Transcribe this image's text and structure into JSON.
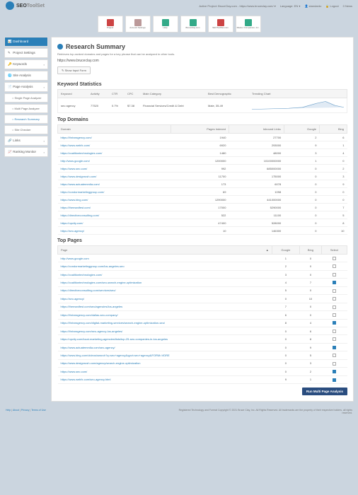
{
  "brand": {
    "main": "SEO",
    "tool": "ToolSet"
  },
  "header": {
    "project": "Active Project: BruceClay.com - https://www.bruceclay.com/ ▾",
    "language": "Language: EN ▾",
    "user": "👤 standardo",
    "logout": "🔒 Logout",
    "notif": "0 News"
  },
  "toolbar": [
    {
      "name": "project",
      "label": "Project",
      "color": "#c44"
    },
    {
      "name": "account",
      "label": "Account Settings",
      "color": "#b99"
    },
    {
      "name": "help",
      "label": "Help",
      "color": "#3a8"
    },
    {
      "name": "bruceclay",
      "label": "BruceClay.com",
      "color": "#3a8"
    },
    {
      "name": "seotoolset",
      "label": "SEOToolSet.com",
      "color": "#c44"
    },
    {
      "name": "master",
      "label": "Master Companion, Inc.",
      "color": "#3a8"
    }
  ],
  "sidebar": {
    "items": [
      {
        "label": "Dashboard",
        "active": true,
        "icon": "📊"
      },
      {
        "label": "Project Settings",
        "icon": "✎",
        "expand": ""
      },
      {
        "label": "Keywords",
        "icon": "🔑",
        "expand": "▪"
      },
      {
        "label": "Site Analysis",
        "icon": "🌐",
        "expand": ""
      },
      {
        "label": "Page Analysis",
        "icon": "📄",
        "expand": "▪",
        "open": true
      },
      {
        "label": "Links",
        "icon": "🔗",
        "expand": "▪"
      },
      {
        "label": "Ranking Monitor",
        "icon": "📈",
        "expand": "▪"
      }
    ],
    "subs": [
      {
        "label": "Single Page Analyzer"
      },
      {
        "label": "Multi Page Analyzer"
      },
      {
        "label": "Research Summary",
        "on": true
      },
      {
        "label": "Site Checker"
      }
    ]
  },
  "page": {
    "title": "Research Summary",
    "desc": "Retrieves top-ranked domains and pages for a key phrase that can be analyzed in other tools.",
    "url": "https://www.bruceclay.com",
    "formBtn": "✎ Show Input Form"
  },
  "kstats": {
    "heading": "Keyword Statistics",
    "cols": [
      "Keyword",
      "Activity",
      "CTR",
      "CPC",
      "Main Category",
      "Best Demographic",
      "Trending Chart"
    ],
    "row": {
      "keyword": "seo agency",
      "activity": "77520",
      "ctr": "0.7%",
      "cpc": "$7.38",
      "cat": "Financial Services/Credit & Debt",
      "demo": "Male, 35-49"
    }
  },
  "domains": {
    "heading": "Top Domains",
    "cols": [
      "Domain",
      "Pages Indexed",
      "Inbound Links",
      "Google",
      "Bing"
    ],
    "rows": [
      {
        "d": "https://thriveagency.com/",
        "pi": "1940",
        "il": "27700",
        "g": "2",
        "b": "6"
      },
      {
        "d": "https://www.webfx.com/",
        "pi": "6920",
        "il": "293000",
        "g": "9",
        "b": "1"
      },
      {
        "d": "https://coalitiontechnologies.com/",
        "pi": "1480",
        "il": "48000",
        "g": "3",
        "b": "4"
      },
      {
        "d": "http://www.google.com/",
        "pi": "1200000",
        "il": "10100000000",
        "g": "1",
        "b": "0"
      },
      {
        "d": "https://www.seo.com/",
        "pi": "992",
        "il": "685000000",
        "g": "0",
        "b": "2"
      },
      {
        "d": "https://www.designrush.com/",
        "pi": "11700",
        "il": "175000",
        "g": "0",
        "b": "3"
      },
      {
        "d": "https://www.actuatemedia.com/",
        "pi": "173",
        "il": "6078",
        "g": "0",
        "b": "9"
      },
      {
        "d": "https://condormarketinggroup.com/",
        "pi": "69",
        "il": "1098",
        "g": "0",
        "b": "0"
      },
      {
        "d": "https://www.bing.com/",
        "pi": "1290000",
        "il": "441000000",
        "g": "0",
        "b": "0"
      },
      {
        "d": "https://themanifest.com/",
        "pi": "17000",
        "il": "5290000",
        "g": "0",
        "b": "7"
      },
      {
        "d": "https://directiveconsulting.com/",
        "pi": "522",
        "il": "11100",
        "g": "0",
        "b": "5"
      },
      {
        "d": "https://upcity.com/",
        "pi": "47400",
        "il": "528000",
        "g": "0",
        "b": "8"
      },
      {
        "d": "https://seo.agency/",
        "pi": "10",
        "il": "146300",
        "g": "0",
        "b": "10"
      }
    ]
  },
  "pages": {
    "heading": "Top Pages",
    "cols": [
      "Page",
      "Google",
      "Bing",
      "Select"
    ],
    "rows": [
      {
        "p": "http://www.google.com",
        "g": "1",
        "b": "0",
        "s": false
      },
      {
        "p": "https://condormarketinggroup.com/los-angeles-seo",
        "g": "2",
        "b": "0",
        "s": false
      },
      {
        "p": "https://coalitiontechnologies.com/",
        "g": "3",
        "b": "0",
        "s": false
      },
      {
        "p": "https://coalitiontechnologies.com/seo-search-engine-optimization",
        "g": "4",
        "b": "7",
        "s": true
      },
      {
        "p": "https://directiveconsulting.com/services/seo/",
        "g": "5",
        "b": "0",
        "s": false
      },
      {
        "p": "https://seo.agency/",
        "g": "0",
        "b": "10",
        "s": false
      },
      {
        "p": "https://themanifest.com/seo/agencies/los-angeles",
        "g": "7",
        "b": "0",
        "s": false
      },
      {
        "p": "https://thriveagency.com/dallas-seo-company/",
        "g": "6",
        "b": "0",
        "s": false
      },
      {
        "p": "https://thriveagency.com/digital-marketing-services/search-engine-optimization-seo/",
        "g": "8",
        "b": "4",
        "s": true
      },
      {
        "p": "https://thriveagency.com/seo-agency-los-angeles/",
        "g": "0",
        "b": "6",
        "s": false
      },
      {
        "p": "https://upcity.com/local-marketing-agencies/lists/top-25-seo-companies-in-los-angeles",
        "g": "0",
        "b": "8",
        "s": false
      },
      {
        "p": "https://www.actuatemedia.com/seo-agency/",
        "g": "0",
        "b": "9",
        "s": true
      },
      {
        "p": "https://www.bing.com/videos/search?q=seo+agency&qpvt=seo+agency&FORM=VDRE",
        "g": "0",
        "b": "5",
        "s": false
      },
      {
        "p": "https://www.designrush.com/agency/search-engine-optimization",
        "g": "0",
        "b": "3",
        "s": false
      },
      {
        "p": "https://www.seo.com/",
        "g": "0",
        "b": "2",
        "s": true
      },
      {
        "p": "https://www.webfx.com/seo-agency.html",
        "g": "9",
        "b": "1",
        "s": true
      }
    ]
  },
  "run": "Run Multi Page Analysis",
  "footer": {
    "left": [
      "Help",
      "About",
      "Privacy",
      "Terms of Use"
    ],
    "right": "Registered Technology and Format Copyright © 2021 Bruce Clay, Inc. All Rights Reserved. All trademarks are the property of their respective holders, all rights reserved."
  }
}
